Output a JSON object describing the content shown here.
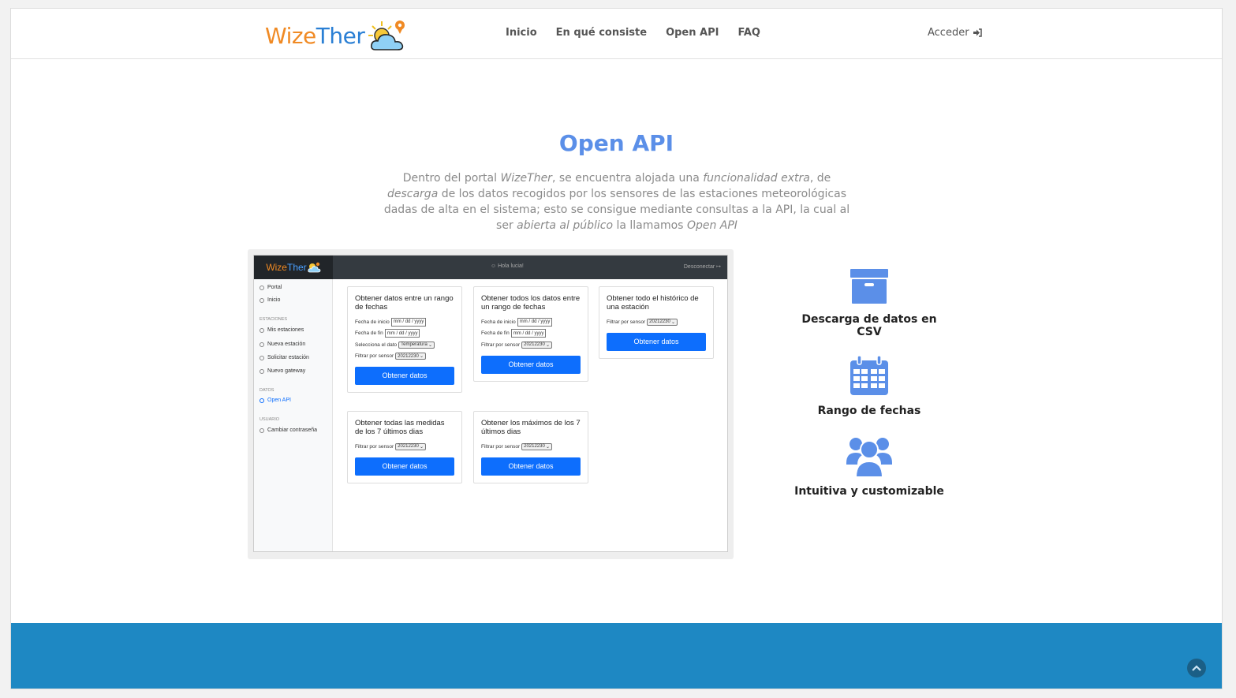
{
  "brand": {
    "name_part1": "Wize",
    "name_part2": "Ther"
  },
  "nav": {
    "items": [
      "Inicio",
      "En qué consiste",
      "Open API",
      "FAQ"
    ],
    "login": "Acceder"
  },
  "section": {
    "title": "Open API",
    "intro": [
      {
        "text": "Dentro del portal ",
        "italic": false
      },
      {
        "text": "WizeTher",
        "italic": true
      },
      {
        "text": ", se encuentra alojada una ",
        "italic": false
      },
      {
        "text": "funcionalidad extra",
        "italic": true
      },
      {
        "text": ", de ",
        "italic": false
      },
      {
        "text": "descarga",
        "italic": true
      },
      {
        "text": " de los datos recogidos por los sensores de las estaciones meteorológicas dadas de alta en el sistema; esto se consigue mediante consultas a la API, la cual al ser ",
        "italic": false
      },
      {
        "text": "abierta al público",
        "italic": true
      },
      {
        "text": " la llamamos ",
        "italic": false
      },
      {
        "text": "Open API",
        "italic": true
      }
    ]
  },
  "screenshot": {
    "brand_part1": "Wize",
    "brand_part2": "Ther",
    "greeting": "Hola lucia!",
    "logout": "Desconectar",
    "sidebar": {
      "top": [
        "Portal",
        "Inicio"
      ],
      "estaciones_heading": "ESTACIONES",
      "estaciones": [
        "Mis estaciones",
        "Nueva estación",
        "Solicitar estación",
        "Nuevo gateway"
      ],
      "datos_heading": "DATOS",
      "datos": [
        "Open API"
      ],
      "usuario_heading": "USUARIO",
      "usuario": [
        "Cambiar contraseña"
      ]
    },
    "cards": [
      {
        "title": "Obtener datos entre un rango de fechas",
        "fields": [
          {
            "label": "Fecha de inicio",
            "type": "input",
            "value": "mm / dd / yyyy"
          },
          {
            "label": "Fecha de fin",
            "type": "input",
            "value": "mm / dd / yyyy"
          },
          {
            "label": "Selecciona el dato",
            "type": "select",
            "value": "Temperatura"
          },
          {
            "label": "Filtrar por sensor",
            "type": "select",
            "value": "20212230"
          }
        ],
        "button": "Obtener datos"
      },
      {
        "title": "Obtener todos los datos entre un rango de fechas",
        "fields": [
          {
            "label": "Fecha de inicio",
            "type": "input",
            "value": "mm / dd / yyyy"
          },
          {
            "label": "Fecha de fin",
            "type": "input",
            "value": "mm / dd / yyyy"
          },
          {
            "label": "Filtrar por sensor",
            "type": "select",
            "value": "20212230"
          }
        ],
        "button": "Obtener datos"
      },
      {
        "title": "Obtener todo el histórico de una estación",
        "fields": [
          {
            "label": "Filtrar por sensor",
            "type": "select",
            "value": "20212230"
          }
        ],
        "button": "Obtener datos"
      },
      {
        "title": "Obtener todas las medidas de los 7 últimos dias",
        "fields": [
          {
            "label": "Filtrar por sensor",
            "type": "select",
            "value": "20212230"
          }
        ],
        "button": "Obtener datos"
      },
      {
        "title": "Obtener los máximos de los 7 últimos dias",
        "fields": [
          {
            "label": "Filtrar por sensor",
            "type": "select",
            "value": "20212230"
          }
        ],
        "button": "Obtener datos"
      }
    ]
  },
  "features": [
    {
      "icon": "archive-icon",
      "label": "Descarga de datos en CSV"
    },
    {
      "icon": "calendar-icon",
      "label": "Rango de fechas"
    },
    {
      "icon": "users-icon",
      "label": "Intuitiva y customizable"
    }
  ],
  "colors": {
    "accent": "#5b8fe8",
    "footer": "#1e88c3",
    "button": "#0d6efd"
  }
}
